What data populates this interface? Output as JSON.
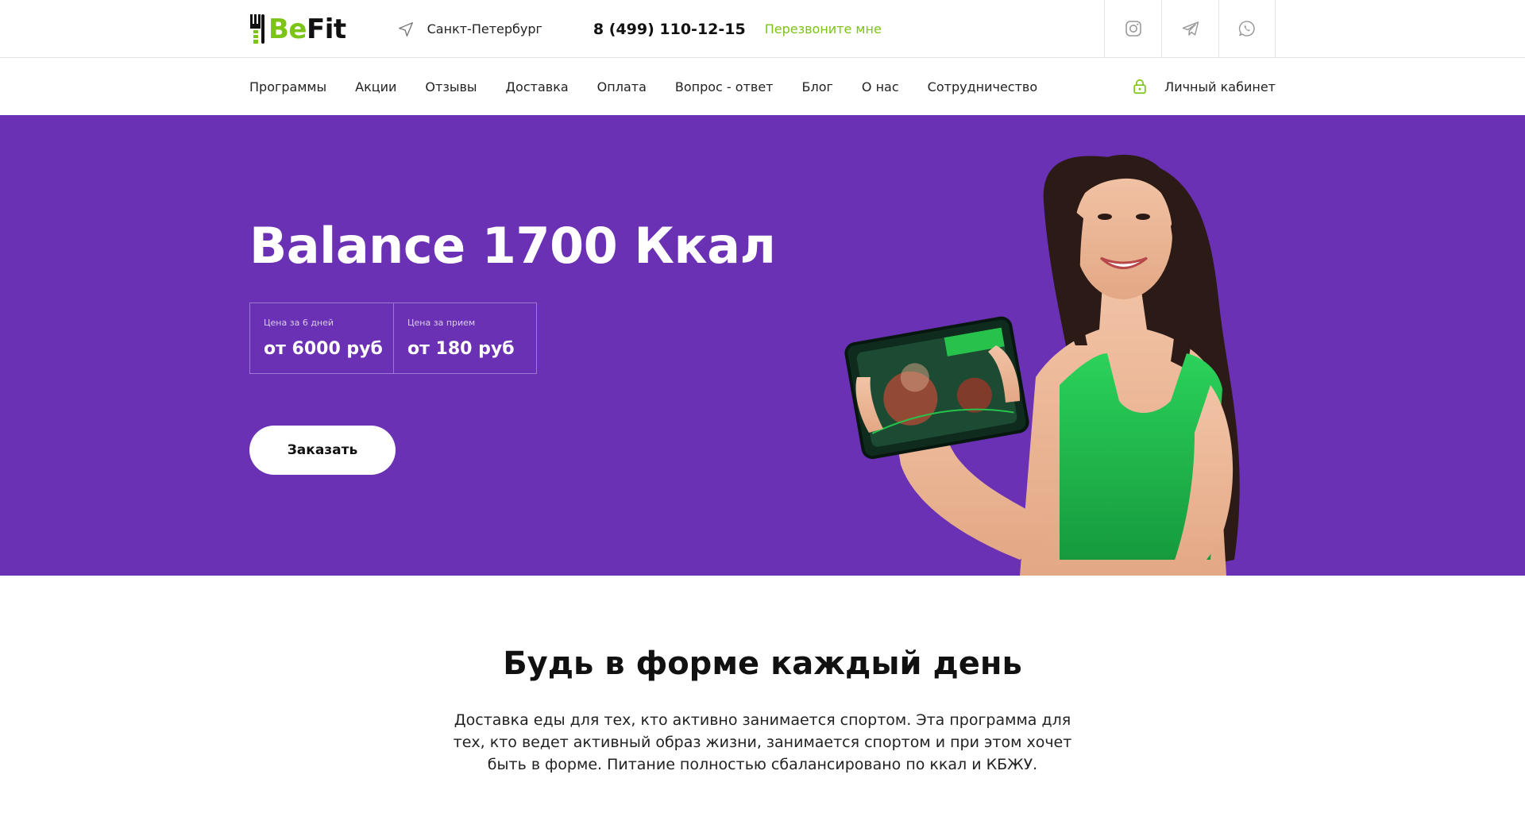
{
  "brand": {
    "logo_part1": "Be",
    "logo_part2": "Fit",
    "accent_color": "#7cc416",
    "hero_bg": "#6a31b4"
  },
  "topbar": {
    "city": "Санкт-Петербург",
    "city_icon": "location-arrow-icon",
    "phone": "8 (499) 110-12-15",
    "callback_label": "Перезвоните мне",
    "socials": [
      "instagram-icon",
      "telegram-icon",
      "whatsapp-icon"
    ]
  },
  "nav": {
    "items": [
      "Программы",
      "Акции",
      "Отзывы",
      "Доставка",
      "Оплата",
      "Вопрос - ответ",
      "Блог",
      "О нас",
      "Сотрудничество"
    ],
    "account_label": "Личный кабинет",
    "account_icon": "lock-icon"
  },
  "hero": {
    "title": "Balance 1700 Ккал",
    "prices": [
      {
        "label": "Цена за 6 дней",
        "value": "от 6000 руб"
      },
      {
        "label": "Цена за прием",
        "value": "от 180 руб"
      }
    ],
    "order_button": "Заказать"
  },
  "intro": {
    "title": "Будь в форме каждый день",
    "text": "Доставка еды для тех, кто активно занимается спортом. Эта программа для тех, кто ведет активный образ жизни, занимается спортом и при этом хочет быть в форме. Питание полностью сбалансировано по ккал и КБЖУ."
  }
}
